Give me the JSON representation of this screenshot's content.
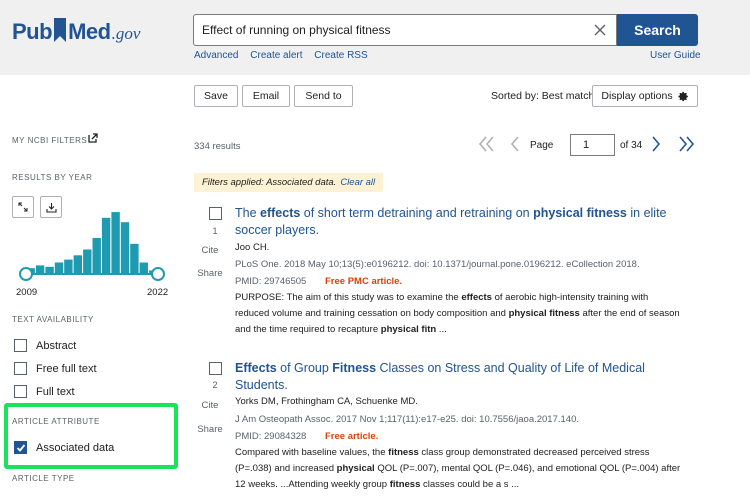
{
  "header": {
    "logo": {
      "pub": "Pub",
      "med": "Med",
      "gov": ".gov"
    },
    "search_value": "Effect of running on physical fitness",
    "search_button": "Search",
    "links": [
      "Advanced",
      "Create alert",
      "Create RSS"
    ],
    "user_guide": "User Guide"
  },
  "toolbar": {
    "save": "Save",
    "email": "Email",
    "send_to": "Send to",
    "sorted_by": "Sorted by: Best match",
    "display_options": "Display options"
  },
  "sidebar": {
    "my_filters": "MY NCBI FILTERS",
    "results_by_year": "RESULTS BY YEAR",
    "year_start": "2009",
    "year_end": "2022",
    "year_histogram": [
      0.08,
      0.12,
      0.1,
      0.16,
      0.2,
      0.26,
      0.34,
      0.5,
      0.78,
      0.86,
      0.72,
      0.42,
      0.16,
      0.05
    ],
    "text_availability": "TEXT AVAILABILITY",
    "text_options": [
      {
        "label": "Abstract",
        "checked": false
      },
      {
        "label": "Free full text",
        "checked": false
      },
      {
        "label": "Full text",
        "checked": false
      }
    ],
    "article_attribute": "ARTICLE ATTRIBUTE",
    "attribute_options": [
      {
        "label": "Associated data",
        "checked": true
      }
    ],
    "article_type": "ARTICLE TYPE"
  },
  "results": {
    "count": "334 results",
    "page_label": "Page",
    "page_value": "1",
    "of_pages": "of 34",
    "filters_applied": "Filters applied: Associated data.",
    "clear_all": "Clear all",
    "cite": "Cite",
    "share": "Share",
    "items": [
      {
        "num": "1",
        "title_pre": "The ",
        "title_b1": "effects",
        "title_mid": " of short term detraining and retraining on ",
        "title_b2": "physical fitness",
        "title_post": " in elite soccer players.",
        "authors": "Joo CH.",
        "journal": "PLoS One. 2018 May 10;13(5):e0196212. doi: 10.1371/journal.pone.0196212. eCollection 2018.",
        "pmid": "PMID: 29746505",
        "free": "Free PMC article.",
        "s1": "PURPOSE: The aim of this study was to examine the ",
        "s1b": "effects",
        "s2": " of aerobic high-intensity training with reduced volume and training cessation on body composition and ",
        "s2b": "physical fitness",
        "s3": " after the end of season and the time required to recapture ",
        "s3b": "physical fitn",
        "s4": " ..."
      },
      {
        "num": "2",
        "title_b1": "Effects",
        "title_mid": " of Group ",
        "title_b2": "Fitness",
        "title_post": " Classes on Stress and Quality of Life of Medical Students.",
        "authors": "Yorks DM, Frothingham CA, Schuenke MD.",
        "journal": "J Am Osteopath Assoc. 2017 Nov 1;117(11):e17-e25. doi: 10.7556/jaoa.2017.140.",
        "pmid": "PMID: 29084328",
        "free": "Free article.",
        "s1": "Compared with baseline values, the ",
        "s1b": "fitness",
        "s2": " class group demonstrated decreased perceived stress (P=.038) and increased ",
        "s2b": "physical",
        "s3": " QOL (P=.007), mental QOL (P=.046), and emotional QOL (P=.004) after 12 weeks. ...Attending weekly group ",
        "s3b": "fitness",
        "s4": " classes could be a s ..."
      }
    ]
  },
  "colors": {
    "brand": "#205493",
    "free": "#d54309",
    "highlight": "#19e35a",
    "histogram_bar": "#1e9bb0"
  }
}
